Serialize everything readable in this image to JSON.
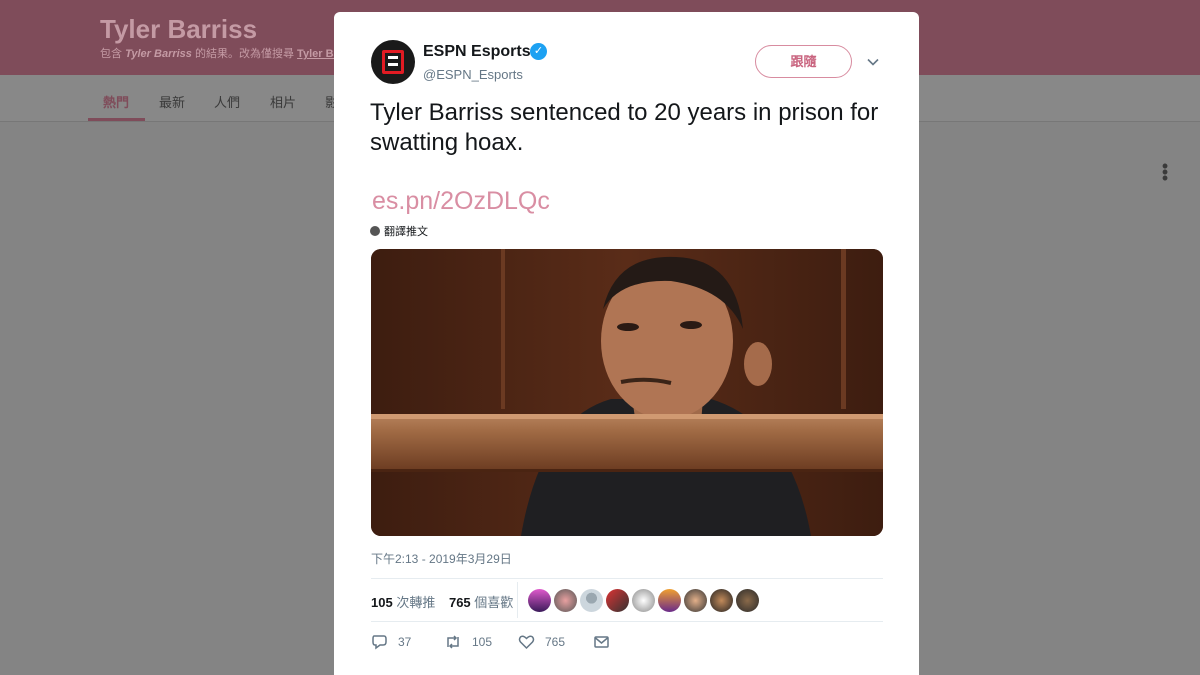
{
  "background_page": {
    "search_title": "Tyler Barriss",
    "subtitle_prefix": "包含",
    "subtitle_query": "Tyler Barriss",
    "subtitle_middle": "的結果。改為僅搜尋",
    "subtitle_link": "Tyler Barr",
    "tabs": [
      {
        "label": "熱門"
      },
      {
        "label": "最新"
      },
      {
        "label": "人們"
      },
      {
        "label": "相片"
      },
      {
        "label": "影"
      }
    ]
  },
  "tweet": {
    "author_name": "ESPN Esports",
    "author_handle": "@ESPN_Esports",
    "follow_label": "跟隨",
    "text": "Tyler Barriss sentenced to 20 years in prison for swatting hoax.",
    "link": "es.pn/2OzDLQc",
    "translate_label": "翻譯推文",
    "timestamp": "下午2:13 - 2019年3月29日",
    "retweet_count": "105",
    "retweet_label": "次轉推",
    "like_count": "765",
    "like_label": "個喜歡",
    "actions": {
      "replies": "37",
      "retweets": "105",
      "likes": "765"
    }
  },
  "colors": {
    "brand_accent": "#d98ea3",
    "header_bg": "#7f4c5a",
    "verified": "#1da1f2"
  }
}
